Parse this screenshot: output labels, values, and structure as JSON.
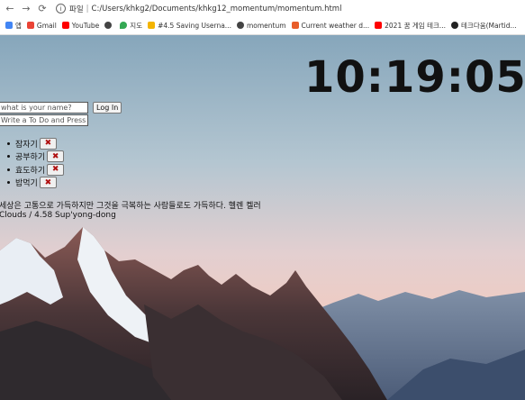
{
  "browser": {
    "address_label": "파일",
    "url": "C:/Users/khkg2/Documents/khkg12_momentum/momentum.html",
    "bookmarks": [
      {
        "label": "앱",
        "color": "#4285f4"
      },
      {
        "label": "Gmail",
        "color": "#ea4335"
      },
      {
        "label": "YouTube",
        "color": "#ff0000"
      },
      {
        "label": "",
        "color": "#444444"
      },
      {
        "label": "지도",
        "color": "#34a853"
      },
      {
        "label": "#4.5 Saving Userna...",
        "color": "#f4b400"
      },
      {
        "label": "momentum",
        "color": "#444444"
      },
      {
        "label": "Current weather d...",
        "color": "#e85d2a"
      },
      {
        "label": "2021 꿈 게임 테크...",
        "color": "#ff0000"
      },
      {
        "label": "테크다움(Martid...",
        "color": "#222222"
      }
    ]
  },
  "clock": {
    "time": "10:19:05"
  },
  "greeting": {
    "name_placeholder": "what is your name?",
    "login_label": "Log In"
  },
  "todo": {
    "placeholder": "Write a To Do and Press Enter",
    "delete_symbol": "✖",
    "items": [
      "잠자기",
      "공부하기",
      "효도하기",
      "밥먹기"
    ]
  },
  "quote": {
    "text": "세상은 고통으로 가득하지만 그것을 극복하는 사람들로도 가득하다. 헬렌 켈러"
  },
  "weather": {
    "text": "Clouds / 4.58 Sup'yong-dong"
  }
}
